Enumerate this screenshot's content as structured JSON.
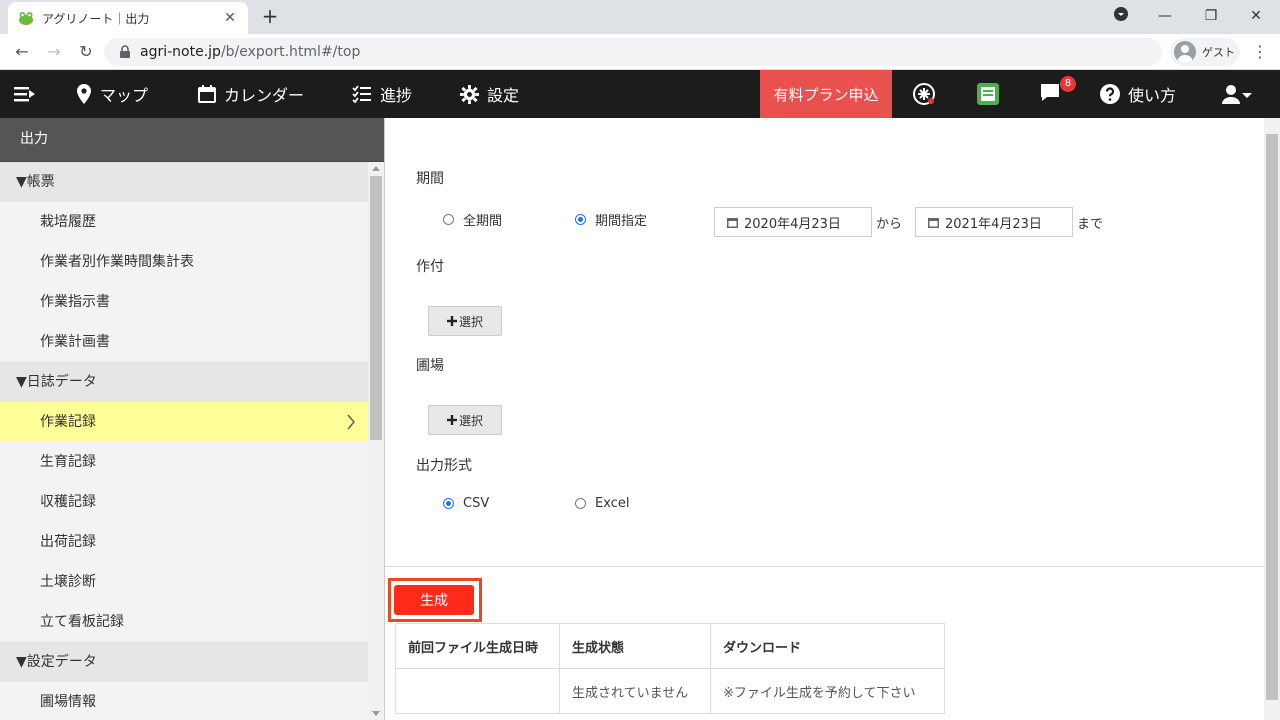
{
  "browser": {
    "tab_title": "アグリノート｜出力",
    "url_host": "agri-note.jp",
    "url_rest": "/b/export.html#/top",
    "profile_label": "ゲスト"
  },
  "nav": {
    "map": "マップ",
    "calendar": "カレンダー",
    "progress": "進捗",
    "settings": "設定",
    "paid_plan": "有料プラン申込",
    "notifications_count": "8",
    "help": "使い方"
  },
  "sidebar": {
    "title": "出力",
    "sections": [
      {
        "label": "▼帳票",
        "items": [
          "栽培履歴",
          "作業者別作業時間集計表",
          "作業指示書",
          "作業計画書"
        ]
      },
      {
        "label": "▼日誌データ",
        "items": [
          "作業記録",
          "生育記録",
          "収穫記録",
          "出荷記録",
          "土壌診断",
          "立て看板記録"
        ]
      },
      {
        "label": "▼設定データ",
        "items": [
          "圃場情報"
        ]
      }
    ]
  },
  "form": {
    "period_label": "期間",
    "period_all": "全期間",
    "period_specified": "期間指定",
    "date_from": "2020年4月23日",
    "from_suffix": "から",
    "date_to": "2021年4月23日",
    "to_suffix": "まで",
    "crop_label": "作付",
    "select_button": "選択",
    "field_label": "圃場",
    "format_label": "出力形式",
    "format_csv": "CSV",
    "format_excel": "Excel",
    "generate_button": "生成"
  },
  "status_table": {
    "headers": [
      "前回ファイル生成日時",
      "生成状態",
      "ダウンロード"
    ],
    "row": [
      "",
      "生成されていません",
      "※ファイル生成を予約して下さい"
    ]
  }
}
